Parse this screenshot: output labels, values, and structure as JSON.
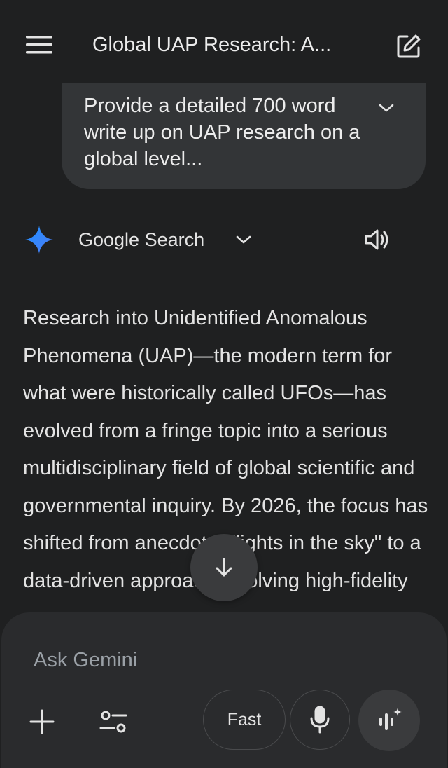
{
  "header": {
    "title": "Global UAP Research: A..."
  },
  "prompt": {
    "text": "Provide a detailed 700 word write up on UAP research on a global level..."
  },
  "source": {
    "label": "Google Search"
  },
  "response": {
    "text": "Research into Unidentified Anomalous Phenomena (UAP)—the modern term for what were historically called UFOs—has evolved from a fringe topic into a serious multidisciplinary field of global scientific and governmental inquiry. By 2026, the focus has shifted from anecdotal \"lights in the sky\" to a data-driven approach involving high-fidelity"
  },
  "composer": {
    "placeholder": "Ask Gemini",
    "mode_label": "Fast"
  },
  "icons": {
    "menu": "hamburger-menu-icon",
    "new_chat": "edit-square-icon",
    "expand": "chevron-down-icon",
    "spark": "gemini-spark-icon",
    "speaker": "speaker-icon",
    "scroll": "arrow-down-icon",
    "plus": "plus-icon",
    "tools": "tune-icon",
    "mic": "microphone-icon",
    "live": "live-audio-icon"
  },
  "colors": {
    "background": "#1f2021",
    "bubble": "#333537",
    "composer": "#2a2b2d",
    "spark_blue": "#4285f4"
  }
}
